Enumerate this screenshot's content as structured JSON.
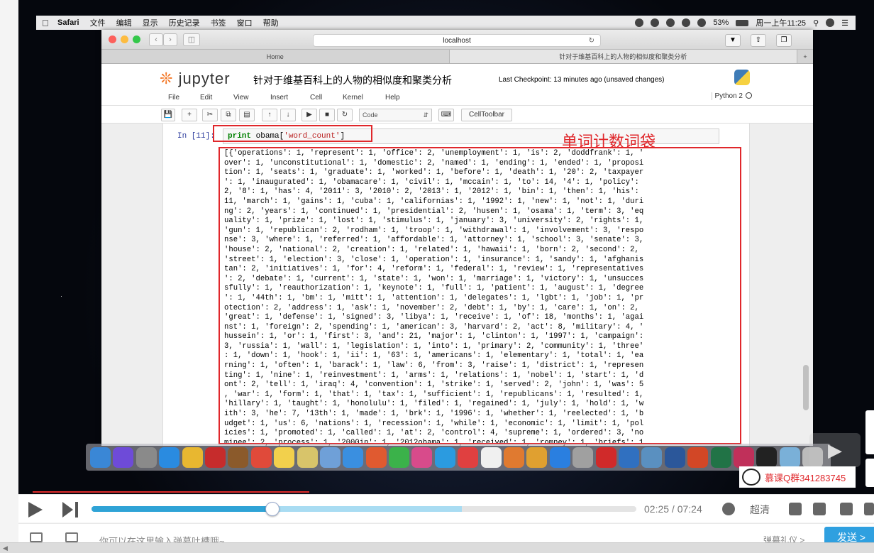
{
  "menubar": {
    "app": "Safari",
    "items": [
      "文件",
      "编辑",
      "显示",
      "历史记录",
      "书签",
      "窗口",
      "帮助"
    ],
    "battery": "53%",
    "clock": "周一上午11:25"
  },
  "safari": {
    "url": "localhost",
    "tabs": [
      "Home",
      "针对于维基百科上的人物的相似度和聚类分析"
    ]
  },
  "jupyter": {
    "logo": "jupyter",
    "notebook_title": "针对于维基百科上的人物的相似度和聚类分析",
    "checkpoint": "Last Checkpoint: 13 minutes ago (unsaved changes)",
    "menu": [
      "File",
      "Edit",
      "View",
      "Insert",
      "Cell",
      "Kernel",
      "Help"
    ],
    "kernel": "Python 2",
    "cell_type": "Code",
    "celltoolbar_label": "CellToolbar"
  },
  "cell": {
    "prompt": "In [11]:",
    "code_kw": "print",
    "code_rest_1": " obama[",
    "code_str": "'word_count'",
    "code_rest_2": "]",
    "output_lines": [
      "[{'operations': 1, 'represent': 1, 'office': 2, 'unemployment': 1, 'is': 2, 'doddfrank': 1, '",
      "over': 1, 'unconstitutional': 1, 'domestic': 2, 'named': 1, 'ending': 1, 'ended': 1, 'proposi",
      "tion': 1, 'seats': 1, 'graduate': 1, 'worked': 1, 'before': 1, 'death': 1, '20': 2, 'taxpayer",
      "': 1, 'inaugurated': 1, 'obamacare': 1, 'civil': 1, 'mccain': 1, 'to': 14, '4': 1, 'policy':",
      "2, '8': 1, 'has': 4, '2011': 3, '2010': 2, '2013': 1, '2012': 1, 'bin': 1, 'then': 1, 'his':",
      "11, 'march': 1, 'gains': 1, 'cuba': 1, 'californias': 1, '1992': 1, 'new': 1, 'not': 1, 'duri",
      "ng': 2, 'years': 1, 'continued': 1, 'presidential': 2, 'husen': 1, 'osama': 1, 'term': 3, 'eq",
      "uality': 1, 'prize': 1, 'lost': 1, 'stimulus': 1, 'january': 3, 'university': 2, 'rights': 1,",
      "'gun': 1, 'republican': 2, 'rodham': 1, 'troop': 1, 'withdrawal': 1, 'involvement': 3, 'respo",
      "nse': 3, 'where': 1, 'referred': 1, 'affordable': 1, 'attorney': 1, 'school': 3, 'senate': 3,",
      "'house': 2, 'national': 2, 'creation': 1, 'related': 1, 'hawaii': 1, 'born': 2, 'second': 2,",
      "'street': 1, 'election': 3, 'close': 1, 'operation': 1, 'insurance': 1, 'sandy': 1, 'afghanis",
      "tan': 2, 'initiatives': 1, 'for': 4, 'reform': 1, 'federal': 1, 'review': 1, 'representatives",
      "': 2, 'debate': 1, 'current': 1, 'state': 1, 'won': 1, 'marriage': 1, 'victory': 1, 'unsucces",
      "sfully': 1, 'reauthorization': 1, 'keynote': 1, 'full': 1, 'patient': 1, 'august': 1, 'degree",
      "': 1, '44th': 1, 'bm': 1, 'mitt': 1, 'attention': 1, 'delegates': 1, 'lgbt': 1, 'job': 1, 'pr",
      "otection': 2, 'address': 1, 'ask': 1, 'november': 2, 'debt': 1, 'by': 1, 'care': 1, 'on': 2,",
      "'great': 1, 'defense': 1, 'signed': 3, 'libya': 1, 'receive': 1, 'of': 18, 'months': 1, 'agai",
      "nst': 1, 'foreign': 2, 'spending': 1, 'american': 3, 'harvard': 2, 'act': 8, 'military': 4, '",
      "hussein': 1, 'or': 1, 'first': 3, 'and': 21, 'major': 1, 'clinton': 1, '1997': 1, 'campaign':",
      "3, 'russia': 1, 'wall': 1, 'legislation': 1, 'into': 1, 'primary': 2, 'community': 1, 'three'",
      ": 1, 'down': 1, 'hook': 1, 'ii': 1, '63': 1, 'americans': 1, 'elementary': 1, 'total': 1, 'ea",
      "rning': 1, 'often': 1, 'barack': 1, 'law': 6, 'from': 3, 'raise': 1, 'district': 1, 'represen",
      "ting': 1, 'nine': 1, 'reinvestment': 1, 'arms': 1, 'relations': 1, 'nobel': 1, 'start': 1, 'd",
      "ont': 2, 'tell': 1, 'iraq': 4, 'convention': 1, 'strike': 1, 'served': 2, 'john': 1, 'was': 5",
      ", 'war': 1, 'form': 1, 'that': 1, 'tax': 1, 'sufficient': 1, 'republicans': 1, 'resulted': 1,",
      "'hillary': 1, 'taught': 1, 'honolulu': 1, 'filed': 1, 'regained': 1, 'july': 1, 'hold': 1, 'w",
      "ith': 3, 'he': 7, '13th': 1, 'made': 1, 'brk': 1, '1996': 1, 'whether': 1, 'reelected': 1, 'b",
      "udget': 1, 'us': 6, 'nations': 1, 'recession': 1, 'while': 1, 'economic': 1, 'limit': 1, 'pol",
      "icies': 1, 'promoted': 1, 'called': 1, 'at': 2, 'control': 4, 'supreme': 1, 'ordered': 3, 'no",
      "minee': 2, 'process': 1, '2000in': 1, '2012obama': 1, 'received': 1, 'romney': 1, 'briefs': 1"
    ]
  },
  "annotation": "单词计数词袋",
  "watermark": "慕课Q群341283745",
  "player": {
    "time_current": "02:25",
    "time_sep": " / ",
    "time_total": "07:24",
    "quality": "超清",
    "progress_played": 0.332,
    "progress_buffered": 0.68,
    "danmu_placeholder": "你可以在这里输入弹幕吐槽哦~",
    "danmu_etiquette": "弹幕礼仪 >",
    "send": "发送 >"
  },
  "colors": {
    "annotation_red": "#e0272b",
    "progress_blue": "#2fa3d6",
    "jupyter_orange": "#f37726"
  }
}
